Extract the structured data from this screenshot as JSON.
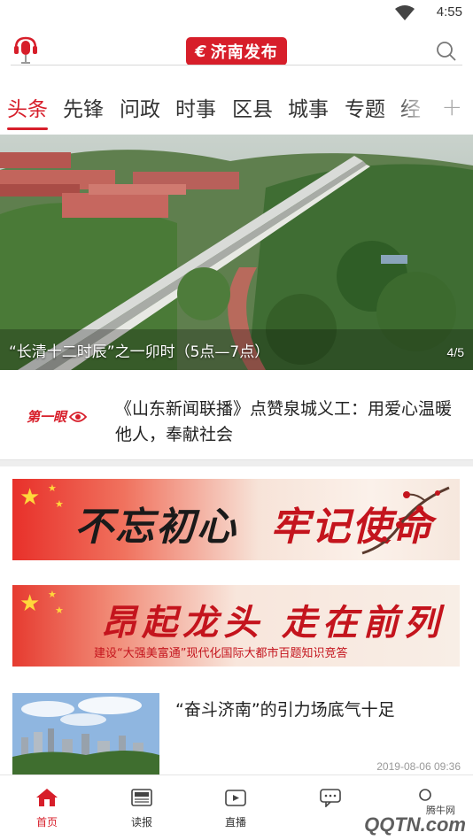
{
  "status_bar": {
    "time": "4:55"
  },
  "header": {
    "logo_text": "济南发布",
    "logo_mark": "€"
  },
  "tabs": [
    {
      "label": "头条",
      "active": true
    },
    {
      "label": "先锋"
    },
    {
      "label": "问政"
    },
    {
      "label": "时事"
    },
    {
      "label": "区县"
    },
    {
      "label": "城事"
    },
    {
      "label": "专题"
    },
    {
      "label": "经"
    }
  ],
  "tabs_add": "+",
  "carousel": {
    "caption": "“长清十二时辰”之一卯时（5点—7点）",
    "counter": "4/5"
  },
  "first_eye": {
    "badge": "第一眼",
    "text": "《山东新闻联播》点赞泉城义工：用爱心温暖他人，奉献社会"
  },
  "banner1": {
    "slogan_a": "不忘初心",
    "slogan_b": "牢记使命"
  },
  "banner2": {
    "slogan": "昂起龙头 走在前列",
    "sub": "建设“大强美富通”现代化国际大都市百题知识竞答"
  },
  "article": {
    "title": "“奋斗济南”的引力场底气十足",
    "date": "2019-08-06 09:36"
  },
  "bottom_nav": [
    {
      "label": "首页",
      "icon": "home-icon",
      "active": true
    },
    {
      "label": "读报",
      "icon": "newspaper-icon"
    },
    {
      "label": "直播",
      "icon": "live-icon"
    },
    {
      "label": "",
      "icon": "message-icon"
    },
    {
      "label": "",
      "icon": "profile-icon"
    }
  ],
  "watermark": {
    "text": "QQTN.com",
    "small": "腾牛网"
  },
  "colors": {
    "brand_red": "#d71e2a"
  }
}
